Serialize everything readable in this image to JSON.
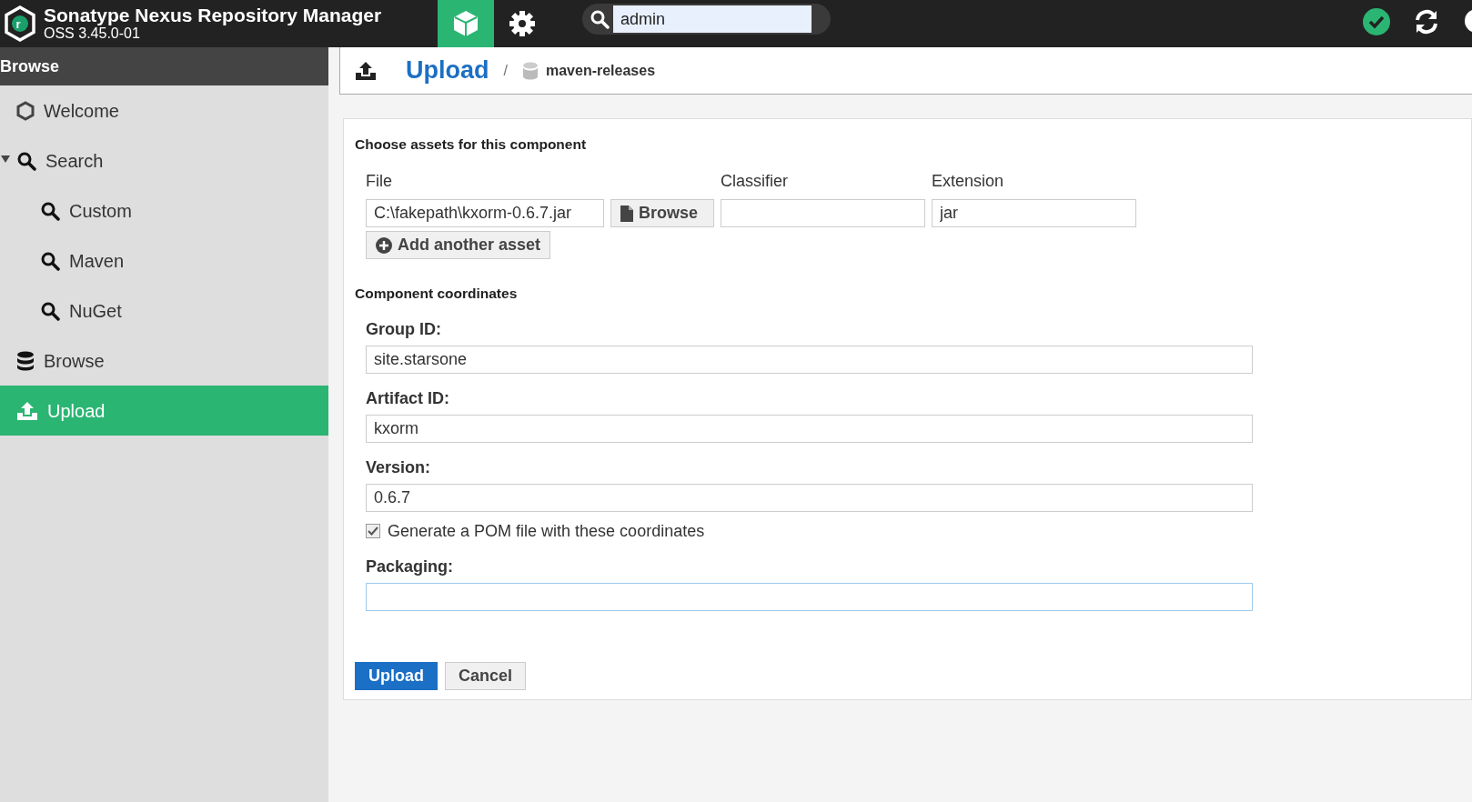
{
  "header": {
    "logo_letter": "r",
    "title": "Sonatype Nexus Repository Manager",
    "version": "OSS 3.45.0-01",
    "modes": [
      {
        "kind": "browse",
        "selected": true
      },
      {
        "kind": "admin",
        "selected": false
      }
    ],
    "search": {
      "value": "admin"
    },
    "status_ok": true
  },
  "sidebar": {
    "title": "Browse",
    "items": [
      {
        "label": "Welcome",
        "kind": "welcome",
        "selected": false
      },
      {
        "label": "Search",
        "kind": "search",
        "selected": false,
        "expanded": true,
        "children": [
          {
            "label": "Custom",
            "kind": "search",
            "selected": false
          },
          {
            "label": "Maven",
            "kind": "search",
            "selected": false
          },
          {
            "label": "NuGet",
            "kind": "search",
            "selected": false
          }
        ]
      },
      {
        "label": "Browse",
        "kind": "browse",
        "selected": false
      },
      {
        "label": "Upload",
        "kind": "upload",
        "selected": true
      }
    ]
  },
  "breadcrumb": {
    "title": "Upload",
    "separator": "/",
    "repository": "maven-releases"
  },
  "form": {
    "assets_heading": "Choose assets for this component",
    "asset_columns": [
      "File",
      "Classifier",
      "Extension"
    ],
    "assets": [
      {
        "file": "C:\\fakepath\\kxorm-0.6.7.jar",
        "browse": "Browse",
        "extension": "jar"
      }
    ],
    "add_asset": "Add another asset",
    "coordinates_heading": "Component coordinates",
    "fields": [
      {
        "label": "Group ID:",
        "value": "site.starsone"
      },
      {
        "label": "Artifact ID:",
        "value": "kxorm"
      },
      {
        "label": "Version:",
        "value": "0.6.7"
      }
    ],
    "checkbox": {
      "label": "Generate a POM file with these coordinates",
      "checked": true
    },
    "packaging": {
      "label": "Packaging:",
      "focused": true
    },
    "buttons": [
      {
        "label": "Upload",
        "kind": "primary"
      },
      {
        "label": "Cancel",
        "kind": "default"
      }
    ]
  }
}
